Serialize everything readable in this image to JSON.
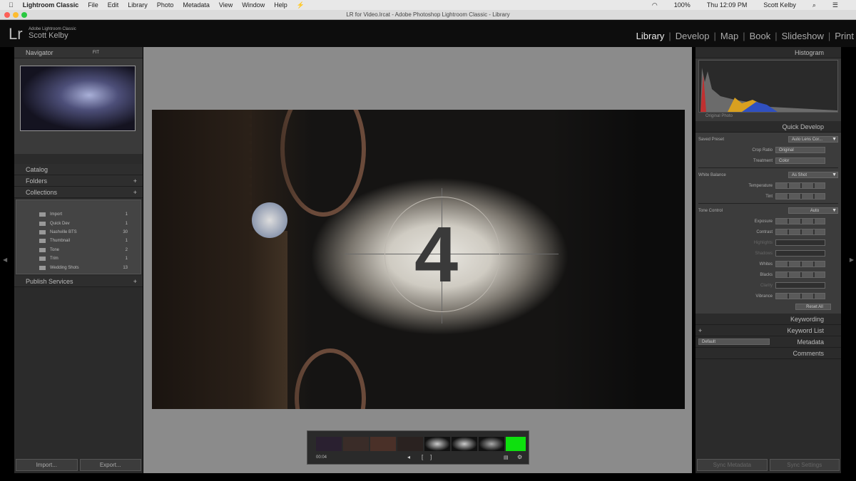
{
  "menubar": {
    "app": "Lightroom Classic",
    "items": [
      "File",
      "Edit",
      "Library",
      "Photo",
      "Metadata",
      "View",
      "Window",
      "Help"
    ],
    "battery": "100%",
    "clock": "Thu 12:09 PM",
    "user": "Scott Kelby"
  },
  "window": {
    "title": "LR for Video.lrcat - Adobe Photoshop Lightroom Classic - Library"
  },
  "identity": {
    "logo": "Lr",
    "product": "Adobe Lightroom Classic",
    "name": "Scott Kelby"
  },
  "modules": [
    "Library",
    "Develop",
    "Map",
    "Book",
    "Slideshow",
    "Print"
  ],
  "active_module": "Library",
  "left": {
    "navigator": "Navigator",
    "fit": "FIT",
    "catalog": "Catalog",
    "folders": "Folders",
    "collections": "Collections",
    "collection_items": [
      {
        "name": "Import",
        "count": "1"
      },
      {
        "name": "Quick Dev",
        "count": "1"
      },
      {
        "name": "Nashville BTS",
        "count": "30"
      },
      {
        "name": "Thumbnail",
        "count": "1"
      },
      {
        "name": "Tone",
        "count": "2"
      },
      {
        "name": "Trim",
        "count": "1"
      },
      {
        "name": "Wedding Shots",
        "count": "13"
      }
    ],
    "publish": "Publish Services",
    "import": "Import...",
    "export": "Export..."
  },
  "photo": {
    "countdown": "4"
  },
  "filmstrip": {
    "time": "00:04",
    "accent": "#1ee01e"
  },
  "right": {
    "histogram": "Histogram",
    "original_photo": "Original Photo",
    "quick_develop": "Quick Develop",
    "saved_preset": "Saved Preset",
    "preset_value": "Auto Lens Cor...",
    "crop_ratio": "Crop Ratio",
    "crop_value": "Original",
    "treatment": "Treatment",
    "treatment_value": "Color",
    "white_balance": "White Balance",
    "wb_value": "As Shot",
    "temperature": "Temperature",
    "tint": "Tint",
    "tone_control": "Tone Control",
    "auto": "Auto",
    "exposure": "Exposure",
    "contrast": "Contrast",
    "highlights": "Highlights",
    "shadows": "Shadows",
    "whites": "Whites",
    "blacks": "Blacks",
    "clarity": "Clarity",
    "vibrance": "Vibrance",
    "reset_all": "Reset All",
    "keywording": "Keywording",
    "keyword_list": "Keyword List",
    "metadata": "Metadata",
    "metadata_preset": "Default",
    "comments": "Comments",
    "sync_metadata": "Sync Metadata",
    "sync_settings": "Sync Settings"
  }
}
